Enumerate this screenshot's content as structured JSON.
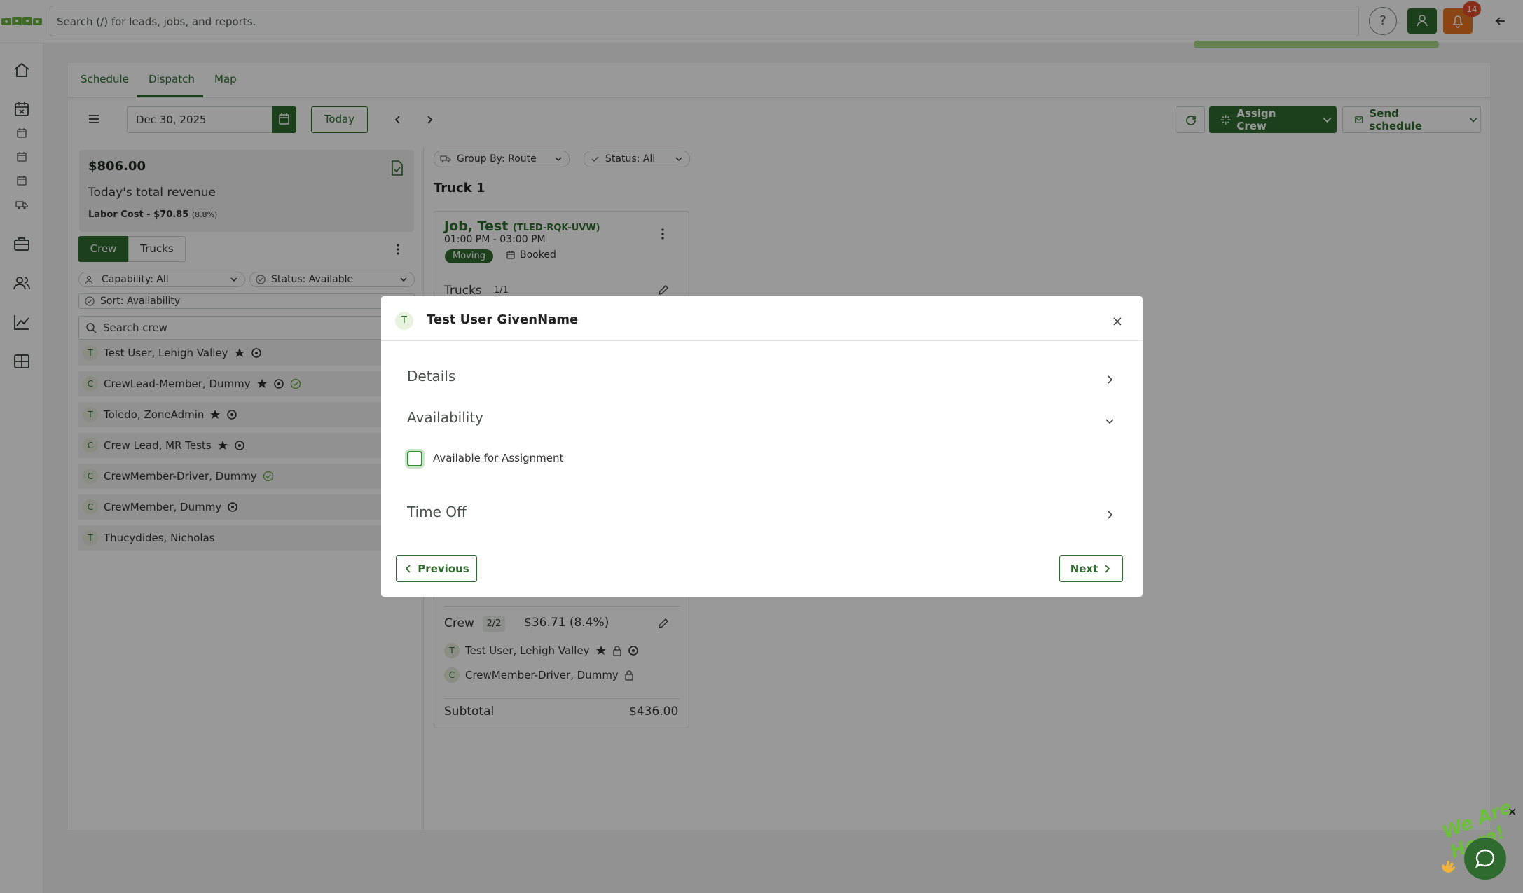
{
  "search": {
    "placeholder": "Search (/) for leads, jobs, and reports."
  },
  "header": {
    "help": "?",
    "notification_count": "14"
  },
  "tabs": {
    "schedule": "Schedule",
    "dispatch": "Dispatch",
    "map": "Map"
  },
  "toolbar": {
    "date": "Dec 30, 2025",
    "today": "Today",
    "assign_crew": "Assign Crew",
    "send_schedule": "Send schedule"
  },
  "revenue": {
    "amount": "$806.00",
    "label": "Today's total revenue",
    "labor_cost": "Labor Cost - $70.85",
    "labor_pct": "(8.8%)"
  },
  "crew_panel": {
    "crew_tab": "Crew",
    "trucks_tab": "Trucks",
    "capability": "Capability: All",
    "status": "Status: Available",
    "sort": "Sort: Availability",
    "search_placeholder": "Search crew"
  },
  "crew_list": [
    {
      "initial": "T",
      "name": "Test User, Lehigh Valley"
    },
    {
      "initial": "C",
      "name": "CrewLead-Member, Dummy"
    },
    {
      "initial": "T",
      "name": "Toledo, ZoneAdmin"
    },
    {
      "initial": "C",
      "name": "Crew Lead, MR Tests"
    },
    {
      "initial": "C",
      "name": "CrewMember-Driver, Dummy"
    },
    {
      "initial": "C",
      "name": "CrewMember, Dummy"
    },
    {
      "initial": "T",
      "name": "Thucydides, Nicholas"
    }
  ],
  "dispatch": {
    "group_by": "Group By: Route",
    "status": "Status: All",
    "truck": "Truck 1",
    "job": {
      "title": "Job, Test",
      "code": "(TLED-RQK-UVW)",
      "time": "01:00 PM - 03:00 PM",
      "badge": "Moving",
      "status": "Booked",
      "trucks_label": "Trucks",
      "trucks_count": "1/1",
      "crew_label": "Crew",
      "crew_count": "2/2",
      "crew_cost": "$36.71 (8.4%)",
      "crew": [
        {
          "initial": "T",
          "name": "Test User, Lehigh Valley"
        },
        {
          "initial": "C",
          "name": "CrewMember-Driver, Dummy"
        }
      ],
      "subtotal_label": "Subtotal",
      "subtotal": "$436.00"
    }
  },
  "modal": {
    "initial": "T",
    "title": "Test User GivenName",
    "details": "Details",
    "availability": "Availability",
    "available_label": "Available for Assignment",
    "available_checked": false,
    "time_off": "Time Off",
    "previous": "Previous",
    "next": "Next"
  },
  "chat": {
    "text": "We Are Here!"
  },
  "colors": {
    "brand": "#2f6b2f",
    "notify": "#e57322",
    "badge": "#e24c28"
  }
}
